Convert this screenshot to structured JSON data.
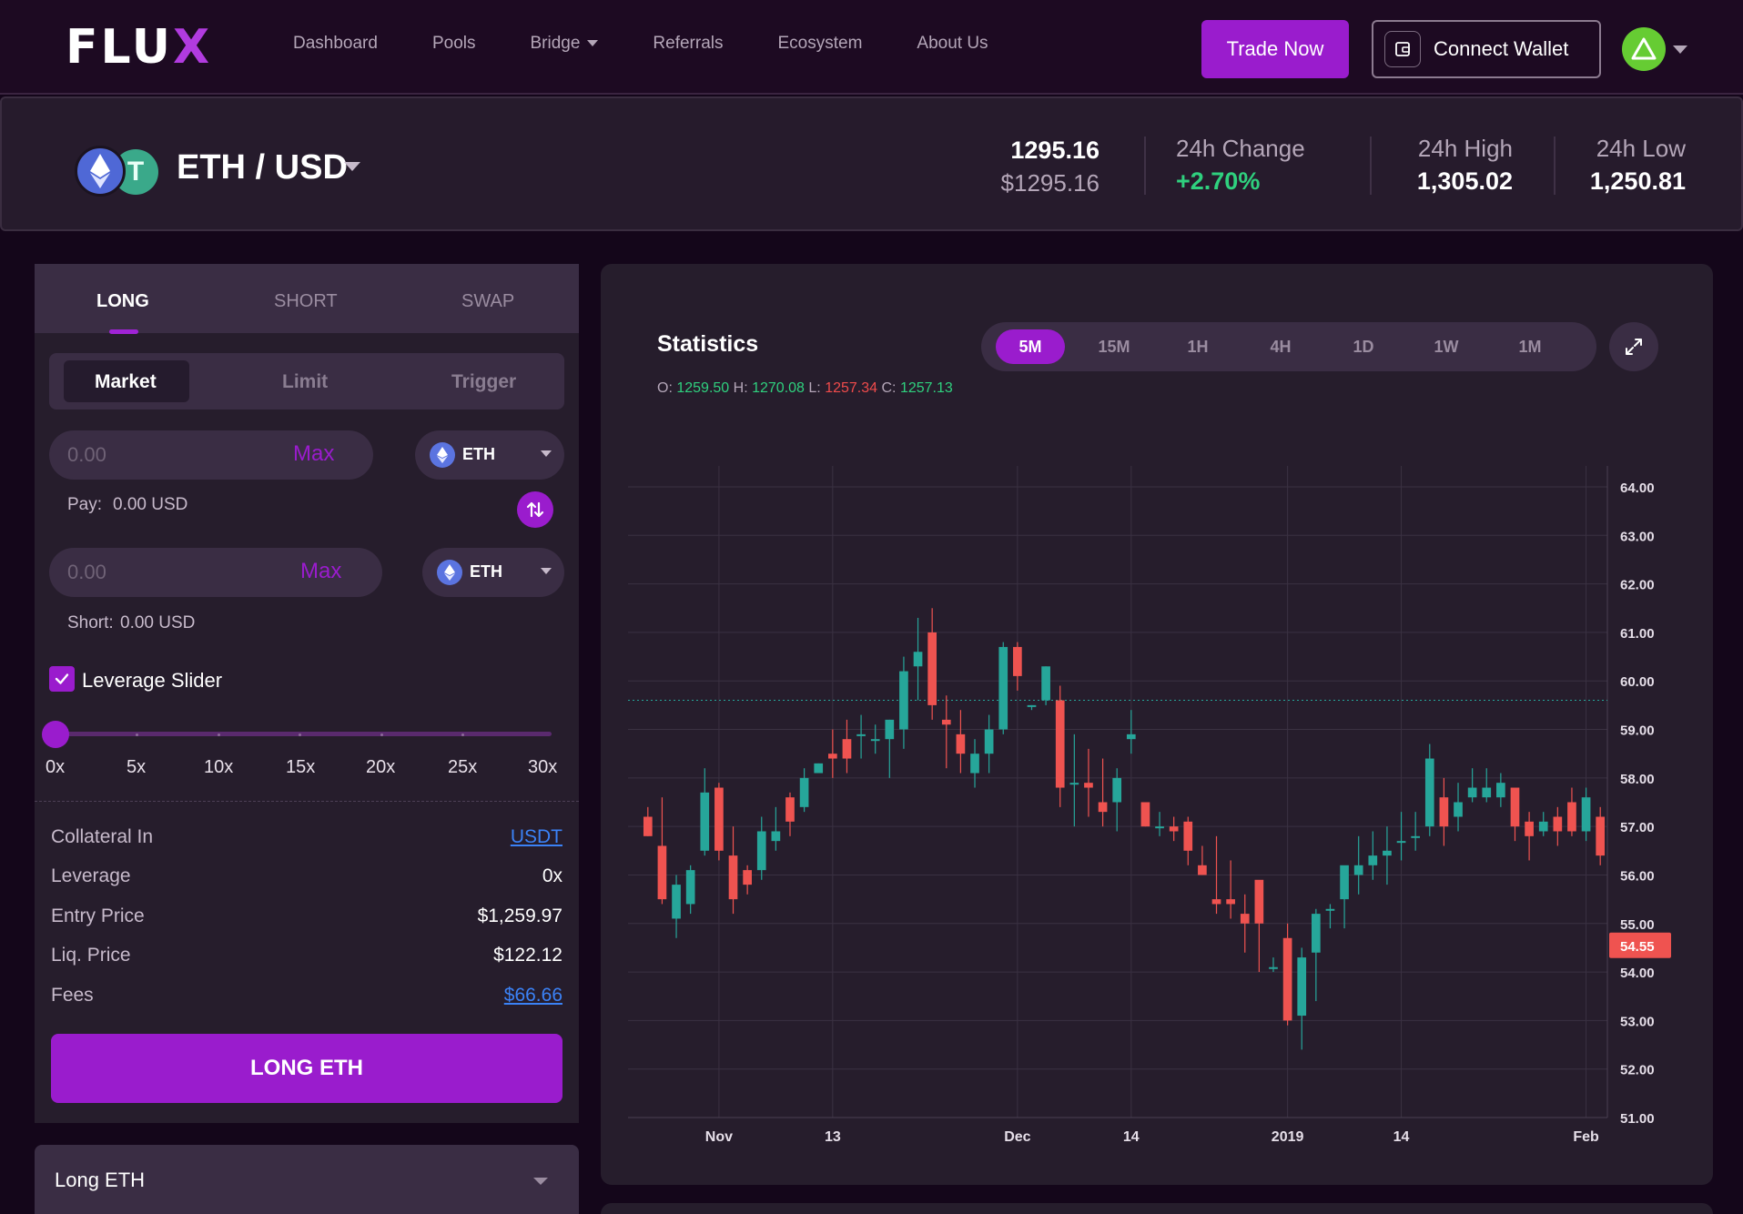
{
  "nav": {
    "logo_main": "FLU",
    "logo_x": "X",
    "links": [
      {
        "label": "Dashboard"
      },
      {
        "label": "Pools"
      },
      {
        "label": "Bridge"
      },
      {
        "label": "Referrals"
      },
      {
        "label": "Ecosystem"
      },
      {
        "label": "About Us"
      }
    ],
    "trade_now": "Trade Now",
    "connect_wallet": "Connect Wallet"
  },
  "ticker": {
    "pair": "ETH / USD",
    "usdt_symbol": "T",
    "price": "1295.16",
    "price_usd": "$1295.16",
    "change_label": "24h Change",
    "change_value": "+2.70%",
    "high_label": "24h High",
    "high_value": "1,305.02",
    "low_label": "24h Low",
    "low_value": "1,250.81"
  },
  "trade": {
    "tabs": [
      "LONG",
      "SHORT",
      "SWAP"
    ],
    "order_types": [
      "Market",
      "Limit",
      "Trigger"
    ],
    "pay_input": {
      "placeholder": "0.00",
      "max": "Max",
      "token": "ETH"
    },
    "pay_label": "Pay:",
    "pay_value": "0.00 USD",
    "short_input": {
      "placeholder": "0.00",
      "max": "Max",
      "token": "ETH"
    },
    "short_label": "Short:",
    "short_value": "0.00 USD",
    "leverage_slider_label": "Leverage Slider",
    "leverage_slider_value": 0,
    "leverage_ticks": [
      "0x",
      "5x",
      "10x",
      "15x",
      "20x",
      "25x",
      "30x"
    ],
    "info": {
      "collateral_label": "Collateral In",
      "collateral_value": "USDT",
      "leverage_label": "Leverage",
      "leverage_value": "0x",
      "entry_label": "Entry Price",
      "entry_value": "$1,259.97",
      "liq_label": "Liq. Price",
      "liq_value": "$122.12",
      "fees_label": "Fees",
      "fees_value": "$66.66"
    },
    "submit": "LONG ETH",
    "accordion": "Long ETH"
  },
  "chart": {
    "title": "Statistics",
    "timeframes": [
      "5M",
      "15M",
      "1H",
      "4H",
      "1D",
      "1W",
      "1M"
    ],
    "active_timeframe": "5M",
    "ohlc": {
      "o_label": "O:",
      "o": "1259.50",
      "h_label": "H:",
      "h": "1270.08",
      "l_label": "L:",
      "l": "1257.34",
      "c_label": "C:",
      "c": "1257.13"
    }
  },
  "colors": {
    "accent": "#9a1ccd",
    "up": "#26a69a",
    "down": "#ef5350",
    "positive_text": "#2fd07e",
    "link": "#3b82f6"
  },
  "chart_data": {
    "type": "candlestick",
    "title": "",
    "xlabel": "",
    "ylabel": "",
    "ylim": [
      51,
      64
    ],
    "yticks": [
      "64.00",
      "63.00",
      "62.00",
      "61.00",
      "60.00",
      "59.00",
      "58.00",
      "57.00",
      "56.00",
      "55.00",
      "54.00",
      "53.00",
      "52.00",
      "51.00"
    ],
    "x_labels": [
      "Nov",
      "13",
      "Dec",
      "14",
      "2019",
      "14",
      "Feb"
    ],
    "x_label_index": [
      5,
      13,
      26,
      34,
      45,
      53,
      66
    ],
    "last_price": 54.55,
    "last_price_label": "54.55",
    "reference_line": 59.6,
    "grid": true,
    "candles": [
      [
        57.2,
        57.4,
        56.8,
        56.8
      ],
      [
        56.6,
        57.6,
        55.4,
        55.5
      ],
      [
        55.1,
        56.0,
        54.7,
        55.8
      ],
      [
        55.4,
        56.2,
        55.2,
        56.1
      ],
      [
        56.5,
        58.2,
        56.4,
        57.7
      ],
      [
        57.8,
        57.9,
        56.3,
        56.5
      ],
      [
        56.4,
        57.0,
        55.2,
        55.5
      ],
      [
        56.1,
        56.2,
        55.6,
        55.8
      ],
      [
        56.1,
        57.2,
        55.9,
        56.9
      ],
      [
        56.7,
        57.4,
        56.5,
        56.9
      ],
      [
        57.6,
        57.7,
        56.8,
        57.1
      ],
      [
        57.4,
        58.2,
        57.3,
        58.0
      ],
      [
        58.1,
        58.3,
        58.1,
        58.3
      ],
      [
        58.5,
        59.0,
        58.0,
        58.4
      ],
      [
        58.8,
        59.2,
        58.1,
        58.4
      ],
      [
        58.9,
        59.3,
        58.4,
        58.9
      ],
      [
        58.8,
        59.1,
        58.5,
        58.8
      ],
      [
        58.8,
        59.2,
        58.0,
        59.2
      ],
      [
        59.0,
        60.5,
        58.6,
        60.2
      ],
      [
        60.3,
        61.3,
        59.6,
        60.6
      ],
      [
        61.0,
        61.5,
        59.2,
        59.5
      ],
      [
        59.2,
        59.7,
        58.2,
        59.1
      ],
      [
        58.9,
        59.4,
        58.1,
        58.5
      ],
      [
        58.1,
        58.8,
        57.8,
        58.5
      ],
      [
        58.5,
        59.3,
        58.1,
        59.0
      ],
      [
        59.0,
        60.8,
        58.9,
        60.7
      ],
      [
        60.7,
        60.8,
        59.8,
        60.1
      ],
      [
        59.5,
        59.5,
        59.4,
        59.5
      ],
      [
        59.6,
        60.3,
        59.5,
        60.3
      ],
      [
        59.6,
        59.9,
        57.4,
        57.8
      ],
      [
        57.9,
        58.9,
        57.0,
        57.9
      ],
      [
        57.9,
        58.6,
        57.2,
        57.8
      ],
      [
        57.5,
        58.4,
        57.0,
        57.3
      ],
      [
        57.5,
        58.2,
        56.9,
        58.0
      ],
      [
        58.8,
        59.4,
        58.5,
        58.9
      ],
      [
        57.5,
        57.5,
        57.0,
        57.0
      ],
      [
        57.0,
        57.3,
        56.8,
        57.0
      ],
      [
        57.0,
        57.2,
        56.7,
        56.9
      ],
      [
        57.1,
        57.2,
        56.2,
        56.5
      ],
      [
        56.2,
        56.6,
        56.0,
        56.0
      ],
      [
        55.5,
        56.8,
        55.2,
        55.4
      ],
      [
        55.5,
        56.3,
        55.1,
        55.4
      ],
      [
        55.2,
        55.6,
        54.4,
        55.0
      ],
      [
        55.9,
        55.4,
        54.0,
        55.0
      ],
      [
        54.1,
        54.3,
        54.0,
        54.1
      ],
      [
        54.7,
        55.0,
        52.9,
        53.0
      ],
      [
        53.1,
        54.5,
        52.4,
        54.3
      ],
      [
        54.4,
        55.3,
        53.4,
        55.2
      ],
      [
        55.3,
        55.4,
        54.9,
        55.3
      ],
      [
        55.5,
        56.0,
        54.9,
        56.2
      ],
      [
        56.0,
        56.8,
        55.6,
        56.2
      ],
      [
        56.2,
        56.9,
        55.9,
        56.4
      ],
      [
        56.4,
        57.0,
        55.8,
        56.5
      ],
      [
        56.7,
        57.3,
        56.3,
        56.7
      ],
      [
        56.8,
        57.3,
        56.5,
        56.8
      ],
      [
        57.0,
        58.7,
        56.8,
        58.4
      ],
      [
        57.6,
        58.0,
        56.6,
        57.0
      ],
      [
        57.2,
        57.9,
        56.9,
        57.5
      ],
      [
        57.6,
        58.2,
        57.5,
        57.8
      ],
      [
        57.6,
        58.2,
        57.5,
        57.8
      ],
      [
        57.6,
        58.1,
        57.4,
        57.9
      ],
      [
        57.8,
        57.8,
        56.7,
        57.0
      ],
      [
        57.1,
        57.3,
        56.3,
        56.8
      ],
      [
        56.9,
        57.3,
        56.8,
        57.1
      ],
      [
        57.2,
        57.4,
        56.6,
        56.9
      ],
      [
        57.5,
        57.8,
        56.8,
        56.9
      ],
      [
        56.9,
        57.8,
        56.7,
        57.6
      ],
      [
        57.2,
        57.4,
        56.2,
        56.4
      ]
    ]
  }
}
